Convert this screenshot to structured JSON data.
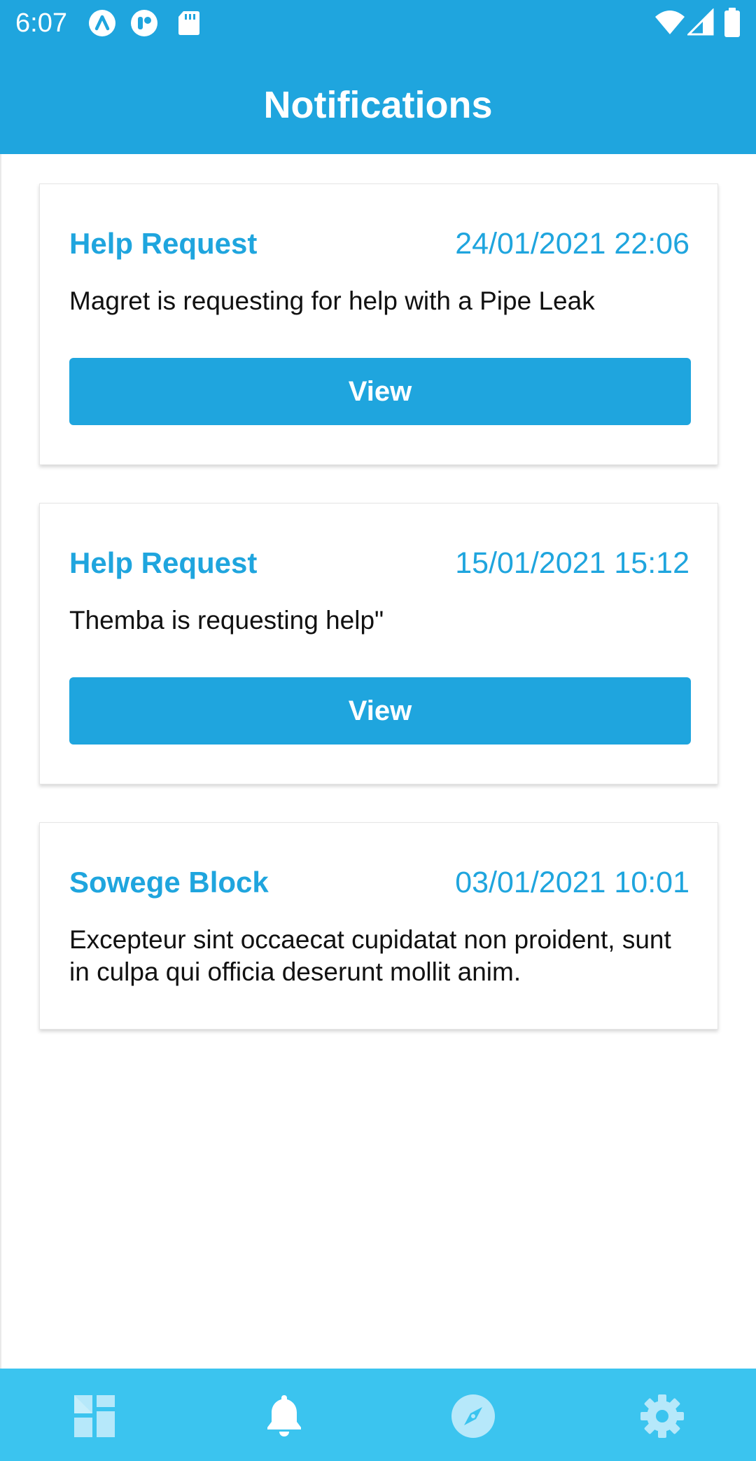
{
  "status_bar": {
    "time": "6:07",
    "left_icons": [
      "app-a-icon",
      "app-r-icon",
      "sd-card-icon"
    ],
    "right_icons": [
      "wifi-icon",
      "signal-icon",
      "battery-icon"
    ]
  },
  "header": {
    "title": "Notifications"
  },
  "notifications": [
    {
      "title": "Help Request",
      "date": "24/01/2021 22:06",
      "message": "Magret is requesting for help with a Pipe Leak",
      "button_label": "View"
    },
    {
      "title": "Help Request",
      "date": "15/01/2021 15:12",
      "message": "Themba is requesting help\"",
      "button_label": "View"
    },
    {
      "title": "Sowege Block",
      "date": "03/01/2021 10:01",
      "message": "Excepteur sint occaecat cupidatat non proident, sunt in culpa qui officia deserunt mollit anim."
    }
  ],
  "bottom_nav": {
    "items": [
      {
        "icon": "dashboard-icon",
        "active": false
      },
      {
        "icon": "bell-icon",
        "active": true
      },
      {
        "icon": "compass-icon",
        "active": false
      },
      {
        "icon": "gear-icon",
        "active": false
      }
    ]
  },
  "colors": {
    "primary": "#1fa5de",
    "nav_background": "#3bc4ef",
    "nav_inactive_icon": "#b6e8fa",
    "active_icon": "#ffffff"
  }
}
